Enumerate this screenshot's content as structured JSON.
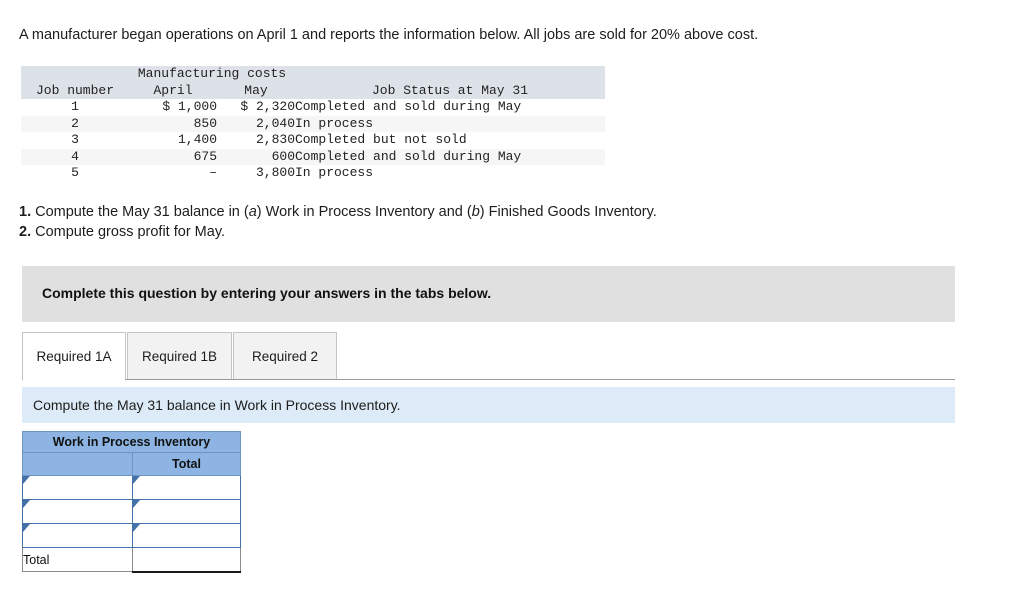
{
  "intro": "A manufacturer began operations on April 1 and reports the information below. All jobs are sold for 20% above cost.",
  "problem_table": {
    "group_header": "Manufacturing costs",
    "columns": [
      "Job number",
      "April",
      "May",
      "Job Status at May 31"
    ],
    "rows": [
      {
        "job": "1",
        "april": "$ 1,000",
        "may": "$ 2,320",
        "status": "Completed and sold during May"
      },
      {
        "job": "2",
        "april": "850",
        "may": "2,040",
        "status": "In process"
      },
      {
        "job": "3",
        "april": "1,400",
        "may": "2,830",
        "status": "Completed but not sold"
      },
      {
        "job": "4",
        "april": "675",
        "may": "600",
        "status": "Completed and sold during May"
      },
      {
        "job": "5",
        "april": "–",
        "may": "3,800",
        "status": "In process"
      }
    ]
  },
  "requirements": {
    "r1_num": "1.",
    "r1_a": " Compute the May 31 balance in (",
    "r1_b": "a",
    "r1_c": ") Work in Process Inventory and (",
    "r1_d": "b",
    "r1_e": ") Finished Goods Inventory.",
    "r2_num": "2.",
    "r2_text": " Compute gross profit for May."
  },
  "banner": {
    "text": "Complete this question by entering your answers in the tabs below."
  },
  "tabs": {
    "items": [
      {
        "label": "Required 1A",
        "active": true
      },
      {
        "label": "Required 1B",
        "active": false
      },
      {
        "label": "Required 2",
        "active": false
      }
    ]
  },
  "prompt": {
    "text": "Compute the May 31 balance in Work in Process Inventory."
  },
  "answer_table": {
    "title": "Work in Process Inventory",
    "sub_blank": "",
    "sub_total": "Total",
    "input_rows": [
      {
        "label": "",
        "value": ""
      },
      {
        "label": "",
        "value": ""
      },
      {
        "label": "",
        "value": ""
      }
    ],
    "total_label": "Total",
    "total_value": ""
  },
  "colors": {
    "header_blue": "#8db4e2",
    "header_blue_border": "#6f94c4",
    "input_border": "#4472a8",
    "banner_gray": "#e0e0e0",
    "prompt_blue": "#dcebf7",
    "table_header_gray": "#dde2e9",
    "stripe_gray": "#f6f6f6"
  }
}
